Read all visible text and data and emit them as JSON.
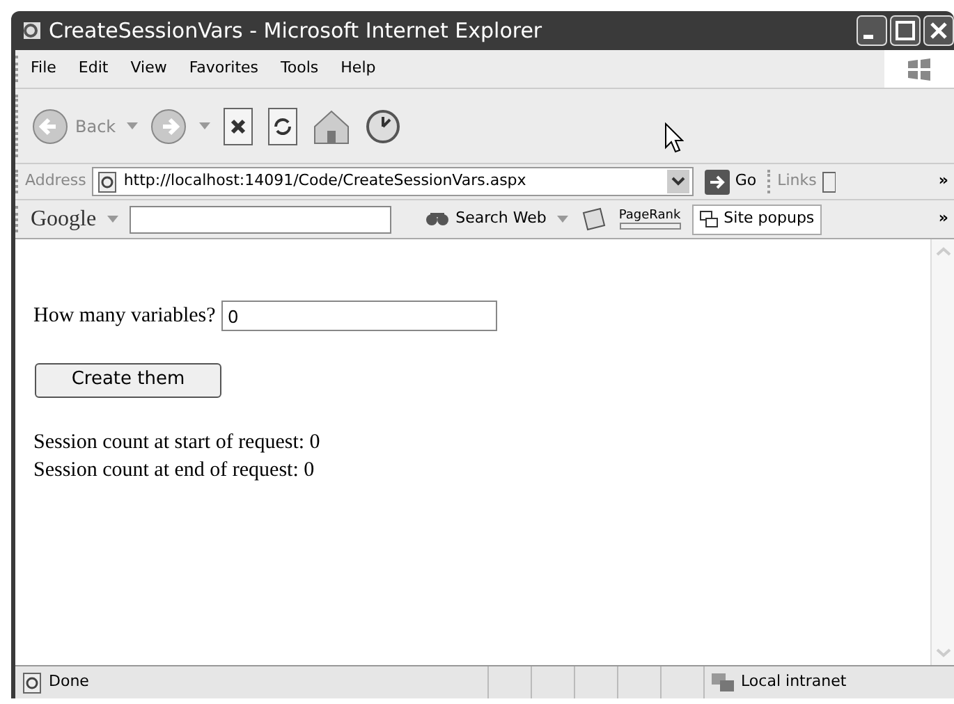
{
  "window": {
    "title": "CreateSessionVars - Microsoft Internet Explorer"
  },
  "menu": [
    "File",
    "Edit",
    "View",
    "Favorites",
    "Tools",
    "Help"
  ],
  "toolbar": {
    "back_label": "Back"
  },
  "address_bar": {
    "label": "Address",
    "url": "http://localhost:14091/Code/CreateSessionVars.aspx",
    "go_label": "Go",
    "links_label": "Links",
    "chevron": "»"
  },
  "google_bar": {
    "logo": "Google",
    "search_label": "Search Web",
    "pagerank_label": "PageRank",
    "popups_label": "Site popups",
    "chevron": "»"
  },
  "page": {
    "variables_label": "How many variables?",
    "variables_value": "0",
    "button": "Create them",
    "lines": [
      "Session count at start of request: 0",
      "Session count at end of request: 0"
    ]
  },
  "status_bar": {
    "status": "Done",
    "zone": "Local intranet"
  }
}
